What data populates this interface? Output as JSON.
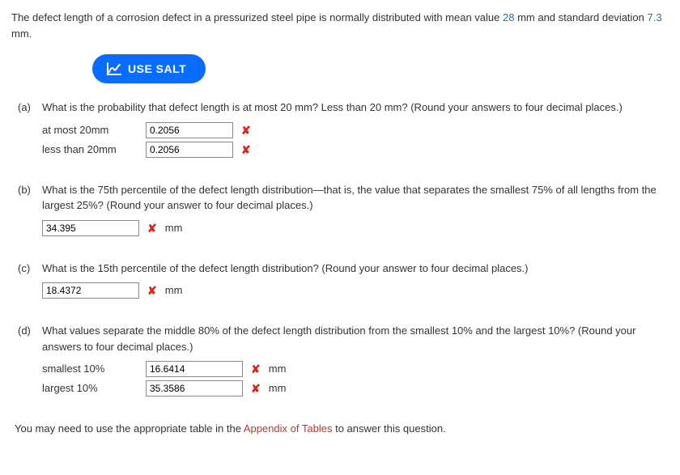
{
  "intro": {
    "prefix": "The defect length of a corrosion defect in a pressurized steel pipe is normally distributed with mean value ",
    "mean": "28",
    "mid1": " mm and standard deviation ",
    "sd": "7.3",
    "suffix": " mm."
  },
  "salt_button": "USE SALT",
  "parts": {
    "a": {
      "label": "(a)",
      "question": "What is the probability that defect length is at most 20 mm? Less than 20 mm? (Round your answers to four decimal places.)",
      "rows": [
        {
          "label": "at most 20mm",
          "value": "0.2056"
        },
        {
          "label": "less than 20mm",
          "value": "0.2056"
        }
      ]
    },
    "b": {
      "label": "(b)",
      "question": "What is the 75th percentile of the defect length distribution—that is, the value that separates the smallest 75% of all lengths from the largest 25%? (Round your answer to four decimal places.)",
      "value": "34.395",
      "unit": "mm"
    },
    "c": {
      "label": "(c)",
      "question": "What is the 15th percentile of the defect length distribution? (Round your answer to four decimal places.)",
      "value": "18.4372",
      "unit": "mm"
    },
    "d": {
      "label": "(d)",
      "question": "What values separate the middle 80% of the defect length distribution from the smallest 10% and the largest 10%? (Round your answers to four decimal places.)",
      "rows": [
        {
          "label": "smallest 10%",
          "value": "16.6414",
          "unit": "mm"
        },
        {
          "label": "largest 10%",
          "value": "35.3586",
          "unit": "mm"
        }
      ]
    }
  },
  "footer": {
    "prefix": "You may need to use the appropriate table in the ",
    "link": "Appendix of Tables",
    "suffix": " to answer this question."
  },
  "wrong_mark": "✘"
}
